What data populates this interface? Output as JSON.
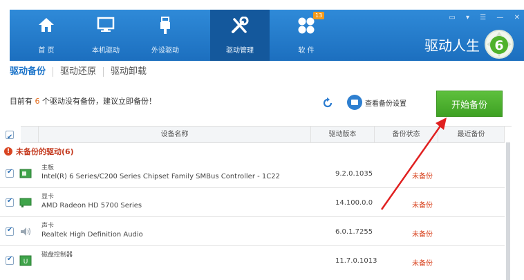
{
  "nav": {
    "items": [
      {
        "label": "首 页",
        "icon": "home-icon"
      },
      {
        "label": "本机驱动",
        "icon": "monitor-icon"
      },
      {
        "label": "外设驱动",
        "icon": "usb-plug-icon"
      },
      {
        "label": "驱动管理",
        "icon": "tools-icon"
      },
      {
        "label": "软 件",
        "icon": "apps-icon",
        "badge": "13"
      }
    ],
    "active_index": 3
  },
  "window_controls": [
    "▭",
    "▾",
    "☰",
    "—",
    "✕"
  ],
  "brand": {
    "title": "驱动人生",
    "logo": "6"
  },
  "subtabs": [
    "驱动备份",
    "驱动还原",
    "驱动卸载"
  ],
  "info": {
    "prefix": "目前有",
    "count": "6",
    "suffix": "个驱动没有备份，建议立即备份！"
  },
  "settings_label": "查看备份设置",
  "start_button": "开始备份",
  "table": {
    "headers": [
      "设备名称",
      "驱动版本",
      "备份状态",
      "最近备份"
    ],
    "group_title": "未备份的驱动(6)",
    "rows": [
      {
        "type": "主板",
        "name": "Intel(R) 6 Series/C200 Series Chipset Family SMBus Controller - 1C22",
        "version": "9.2.0.1035",
        "status": "未备份",
        "icon": "motherboard-icon"
      },
      {
        "type": "显卡",
        "name": "AMD Radeon HD 5700 Series",
        "version": "14.100.0.0",
        "status": "未备份",
        "icon": "display-card-icon"
      },
      {
        "type": "声卡",
        "name": "Realtek High Definition Audio",
        "version": "6.0.1.7255",
        "status": "未备份",
        "icon": "speaker-icon"
      },
      {
        "type": "磁盘控制器",
        "name": "",
        "version": "11.7.0.1013",
        "status": "未备份",
        "icon": "disk-controller-icon"
      }
    ]
  },
  "colors": {
    "header_blue": "#1c6fbf",
    "active_tab": "#14589c",
    "green_button": "#4caf2f",
    "warning_red": "#d8431f",
    "count_orange": "#e36a19"
  }
}
